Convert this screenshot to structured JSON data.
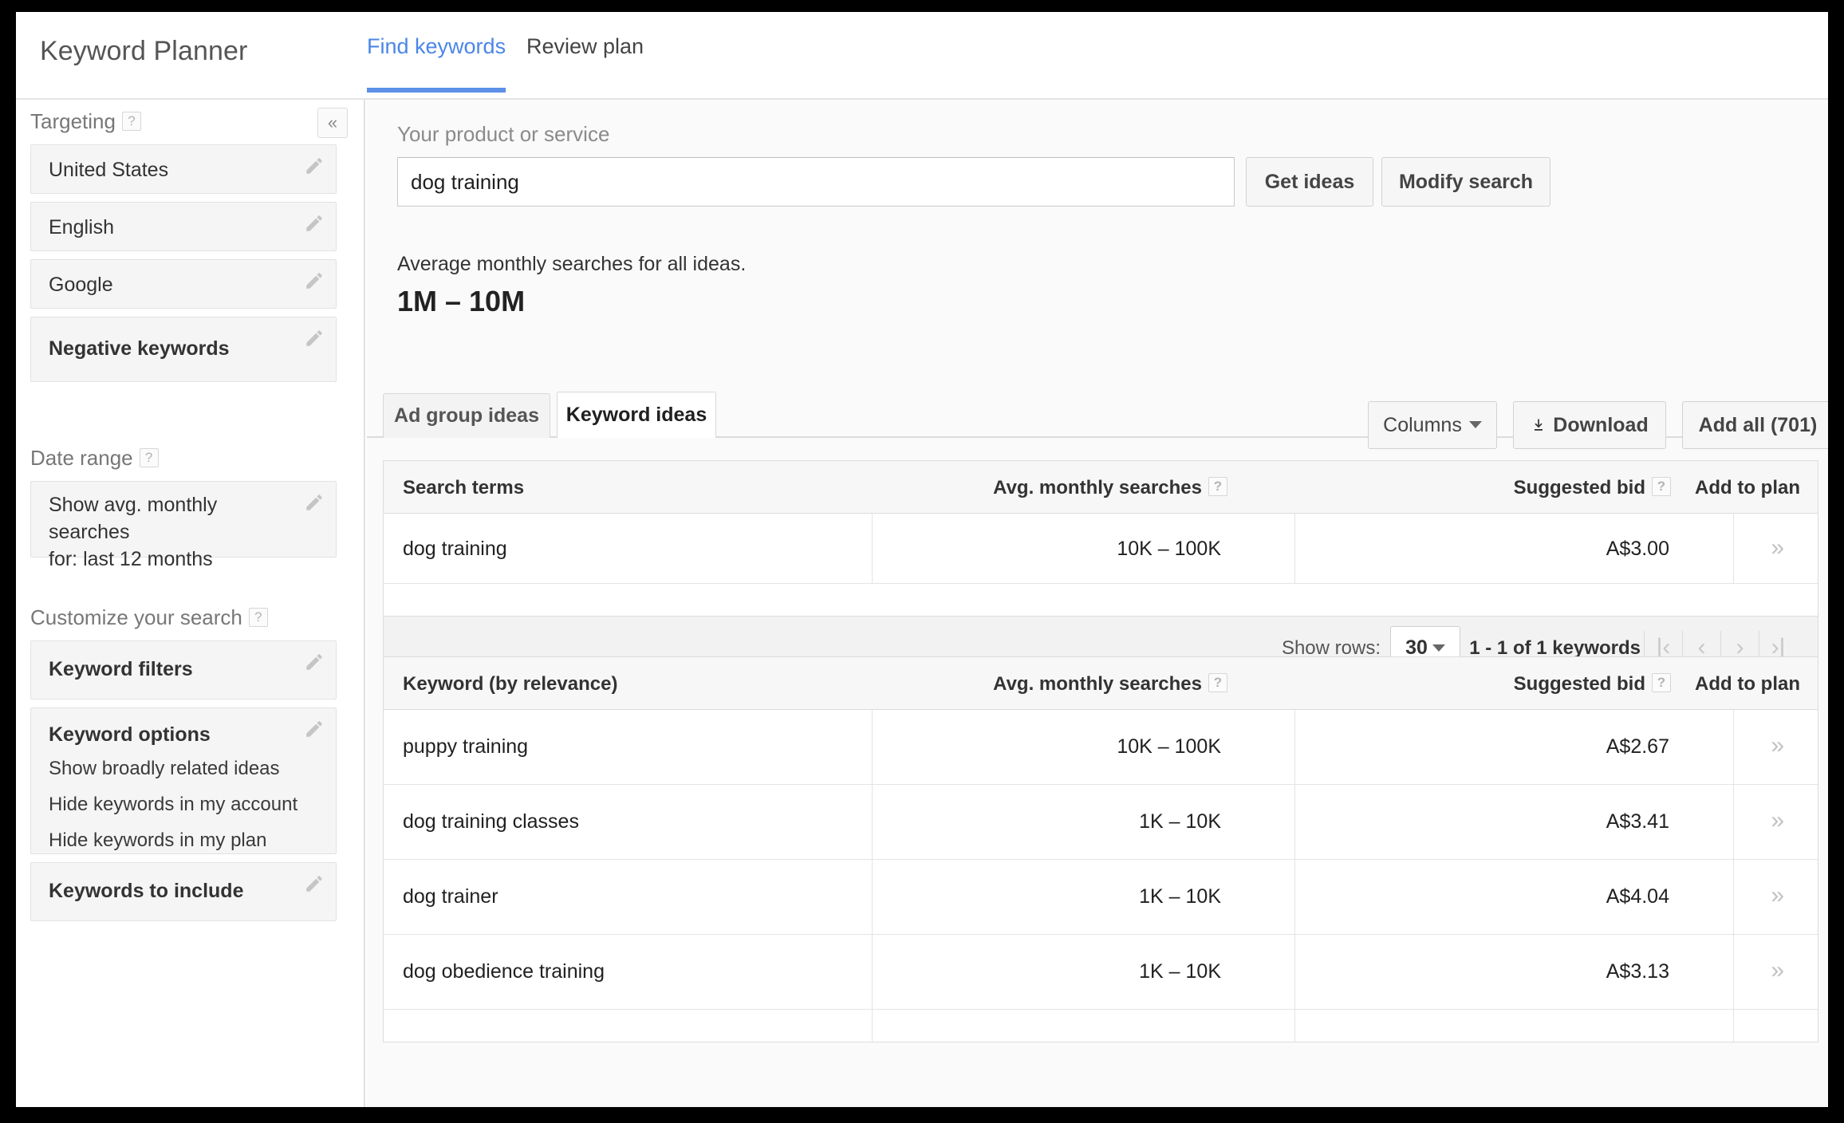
{
  "header": {
    "app_title": "Keyword Planner",
    "tabs": [
      {
        "label": "Find keywords",
        "active": true
      },
      {
        "label": "Review plan",
        "active": false
      }
    ]
  },
  "sidebar": {
    "collapse_icon": "double-chevron-left",
    "sections": [
      {
        "title": "Targeting",
        "help": "?",
        "items": [
          {
            "label": "United States",
            "bold": false
          },
          {
            "label": "English",
            "bold": false
          },
          {
            "label": "Google",
            "bold": false
          },
          {
            "label": "Negative keywords",
            "bold": true
          }
        ]
      },
      {
        "title": "Date range",
        "help": "?",
        "items": [
          {
            "label": "Show avg. monthly searches\nfor: last 12 months",
            "bold": false
          }
        ]
      },
      {
        "title": "Customize your search",
        "help": "?",
        "items": [
          {
            "label": "Keyword filters",
            "bold": true
          },
          {
            "label": "Keyword options",
            "bold": true,
            "sub": [
              "Show broadly related ideas",
              "Hide keywords in my account",
              "Hide keywords in my plan"
            ]
          },
          {
            "label": "Keywords to include",
            "bold": true
          }
        ]
      }
    ]
  },
  "main": {
    "product_label": "Your product or service",
    "search_value": "dog training",
    "search_placeholder": "Your product or service",
    "get_ideas_label": "Get ideas",
    "modify_search_label": "Modify search",
    "avg_caption": "Average monthly searches for all ideas.",
    "avg_value": "1M – 10M",
    "inner_tabs": [
      {
        "label": "Ad group ideas",
        "active": false
      },
      {
        "label": "Keyword ideas",
        "active": true
      }
    ],
    "toolbar": {
      "columns_label": "Columns",
      "download_label": "Download",
      "add_all_label": "Add all (701)"
    },
    "search_terms_table": {
      "columns": [
        "Search terms",
        "Avg. monthly searches",
        "Suggested bid",
        "Add to plan"
      ],
      "rows": [
        {
          "term": "dog training",
          "avg": "10K – 100K",
          "bid": "A$3.00",
          "add": "»"
        }
      ],
      "pager": {
        "show_rows_label": "Show rows:",
        "rows_value": "30",
        "count_label": "1 - 1 of 1 keywords",
        "first": "|‹",
        "prev": "‹",
        "next": "›",
        "last": "›|"
      }
    },
    "keyword_ideas_table": {
      "columns": [
        "Keyword (by relevance)",
        "Avg. monthly searches",
        "Suggested bid",
        "Add to plan"
      ],
      "rows": [
        {
          "term": "puppy training",
          "avg": "10K – 100K",
          "bid": "A$2.67",
          "add": "»"
        },
        {
          "term": "dog training classes",
          "avg": "1K – 10K",
          "bid": "A$3.41",
          "add": "»"
        },
        {
          "term": "dog trainer",
          "avg": "1K – 10K",
          "bid": "A$4.04",
          "add": "»"
        },
        {
          "term": "dog obedience training",
          "avg": "1K – 10K",
          "bid": "A$3.13",
          "add": "»"
        }
      ]
    }
  },
  "colors": {
    "accent_blue": "#5b8fe8",
    "tab_link": "#4a86e8",
    "panel_bg": "#fafafa",
    "box_bg": "#f5f5f5"
  }
}
